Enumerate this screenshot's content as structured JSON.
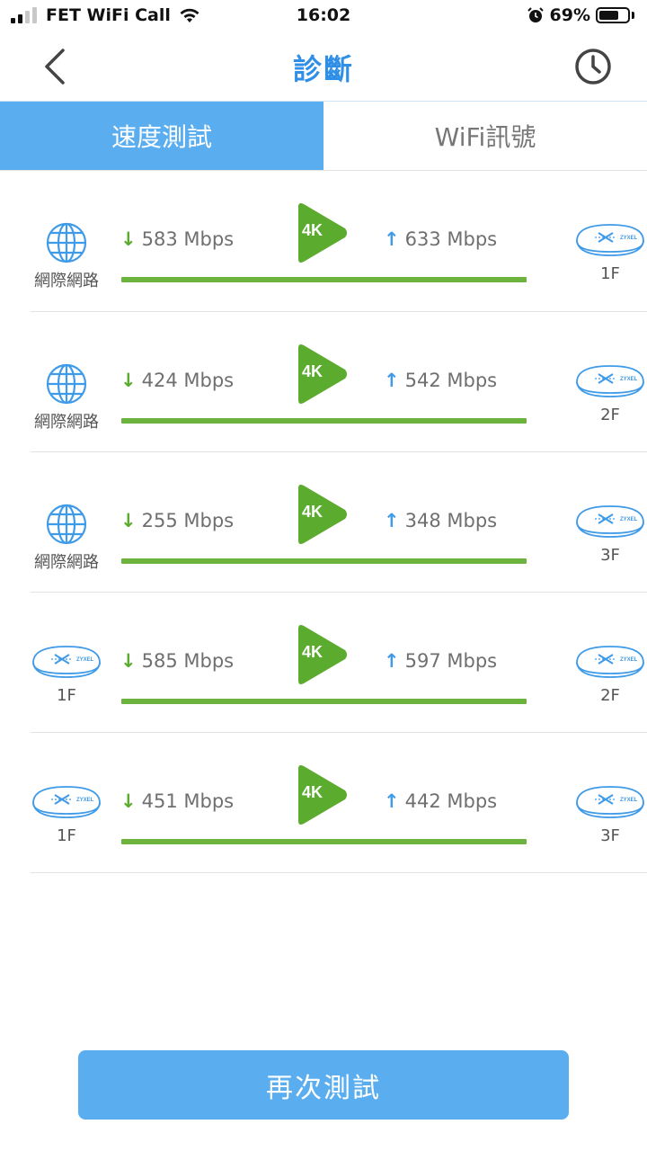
{
  "status_bar": {
    "carrier": "FET WiFi Call",
    "time": "16:02",
    "battery_percent": "69%",
    "battery_level": 0.69,
    "signal_bars": 4,
    "signal_active": 2,
    "icons": [
      "signal-icon",
      "wifi-icon",
      "alarm-icon",
      "battery-icon"
    ]
  },
  "nav": {
    "title": "診斷",
    "back_icon": "chevron-left-icon",
    "history_icon": "clock-icon"
  },
  "tabs": [
    {
      "label": "速度測試",
      "active": true
    },
    {
      "label": "WiFi訊號",
      "active": false
    }
  ],
  "badge_label": "4K",
  "rows": [
    {
      "left_type": "internet",
      "left_label": "網際網路",
      "down": "583 Mbps",
      "up": "633 Mbps",
      "right_label": "1F"
    },
    {
      "left_type": "internet",
      "left_label": "網際網路",
      "down": "424 Mbps",
      "up": "542 Mbps",
      "right_label": "2F"
    },
    {
      "left_type": "internet",
      "left_label": "網際網路",
      "down": "255 Mbps",
      "up": "348 Mbps",
      "right_label": "3F"
    },
    {
      "left_type": "router",
      "left_label": "1F",
      "down": "585 Mbps",
      "up": "597 Mbps",
      "right_label": "2F"
    },
    {
      "left_type": "router",
      "left_label": "1F",
      "down": "451 Mbps",
      "up": "442 Mbps",
      "right_label": "3F"
    }
  ],
  "router_brand": "ZYXEL",
  "arrows": {
    "down": "↓",
    "up": "↑"
  },
  "retest_button": "再次測試",
  "colors": {
    "accent": "#5aaeef",
    "title": "#2f8fe6",
    "bar": "#6cb33e",
    "badge": "#5aab2e"
  }
}
